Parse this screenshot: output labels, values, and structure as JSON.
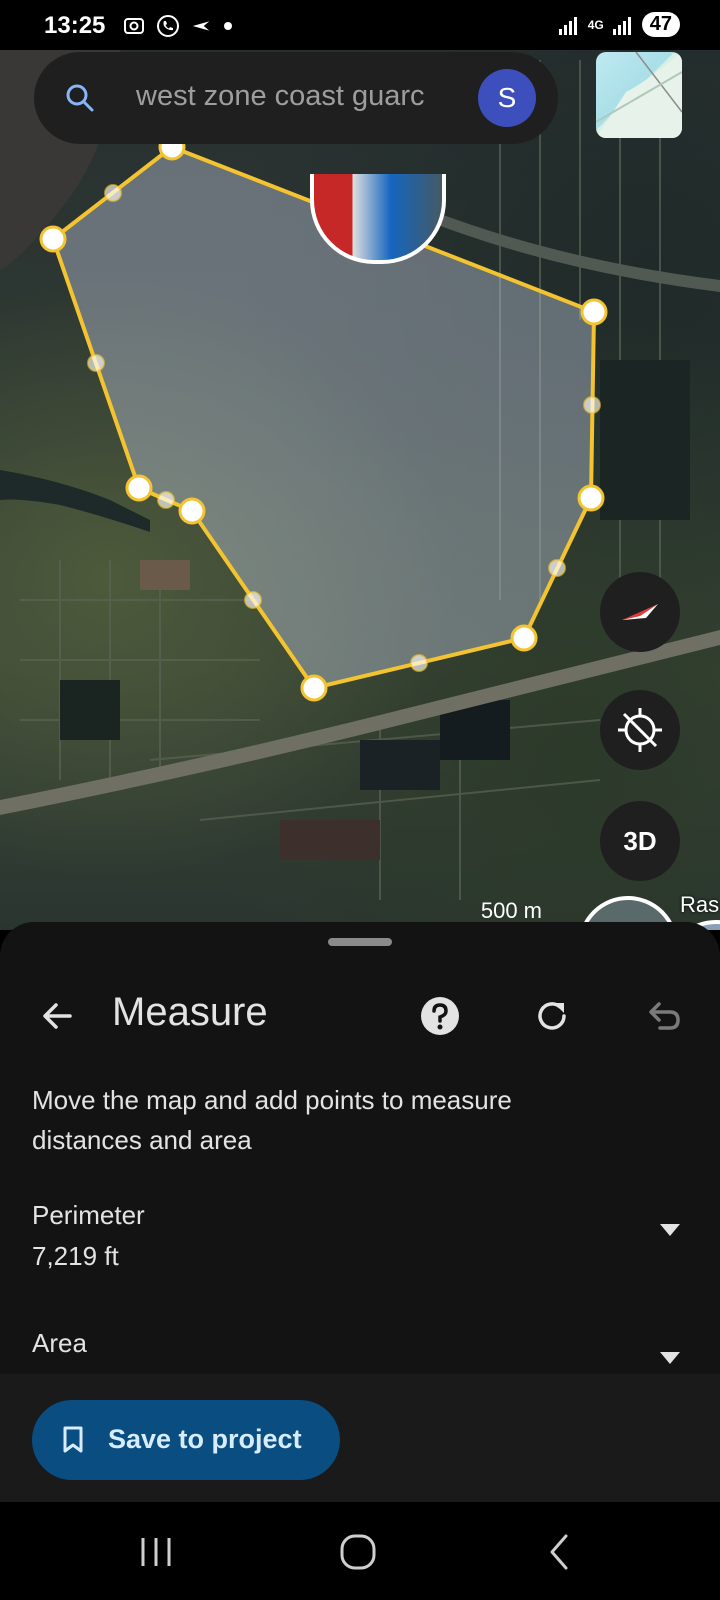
{
  "status_bar": {
    "time": "13:25",
    "network": "4G",
    "battery": "47"
  },
  "search": {
    "query": "west zone coast guarc",
    "avatar_letter": "S"
  },
  "map": {
    "scale_label": "500 m",
    "poi_label": "Ras"
  },
  "map_controls": {
    "three_d_label": "3D"
  },
  "measure_panel": {
    "title": "Measure",
    "instruction": "Move the map and add points to measure distances and area",
    "perimeter_label": "Perimeter",
    "perimeter_value": "7,219 ft",
    "area_label": "Area"
  },
  "footer": {
    "save_label": "Save to project"
  },
  "colors": {
    "polygon_outline": "#f4c430",
    "polygon_fill": "rgba(190,200,220,0.42)",
    "save_button_bg": "#0a4d80",
    "avatar_bg": "#3d4fbd",
    "sheet_bg": "#131313"
  },
  "icons": [
    "search-icon",
    "camera-icon",
    "phone-icon",
    "flight-icon",
    "signal-icon",
    "back-arrow-icon",
    "help-icon",
    "refresh-icon",
    "undo-icon",
    "chevron-down-icon",
    "bookmark-icon",
    "compass-icon",
    "location-off-icon",
    "recents-icon",
    "home-icon",
    "nav-back-icon"
  ]
}
